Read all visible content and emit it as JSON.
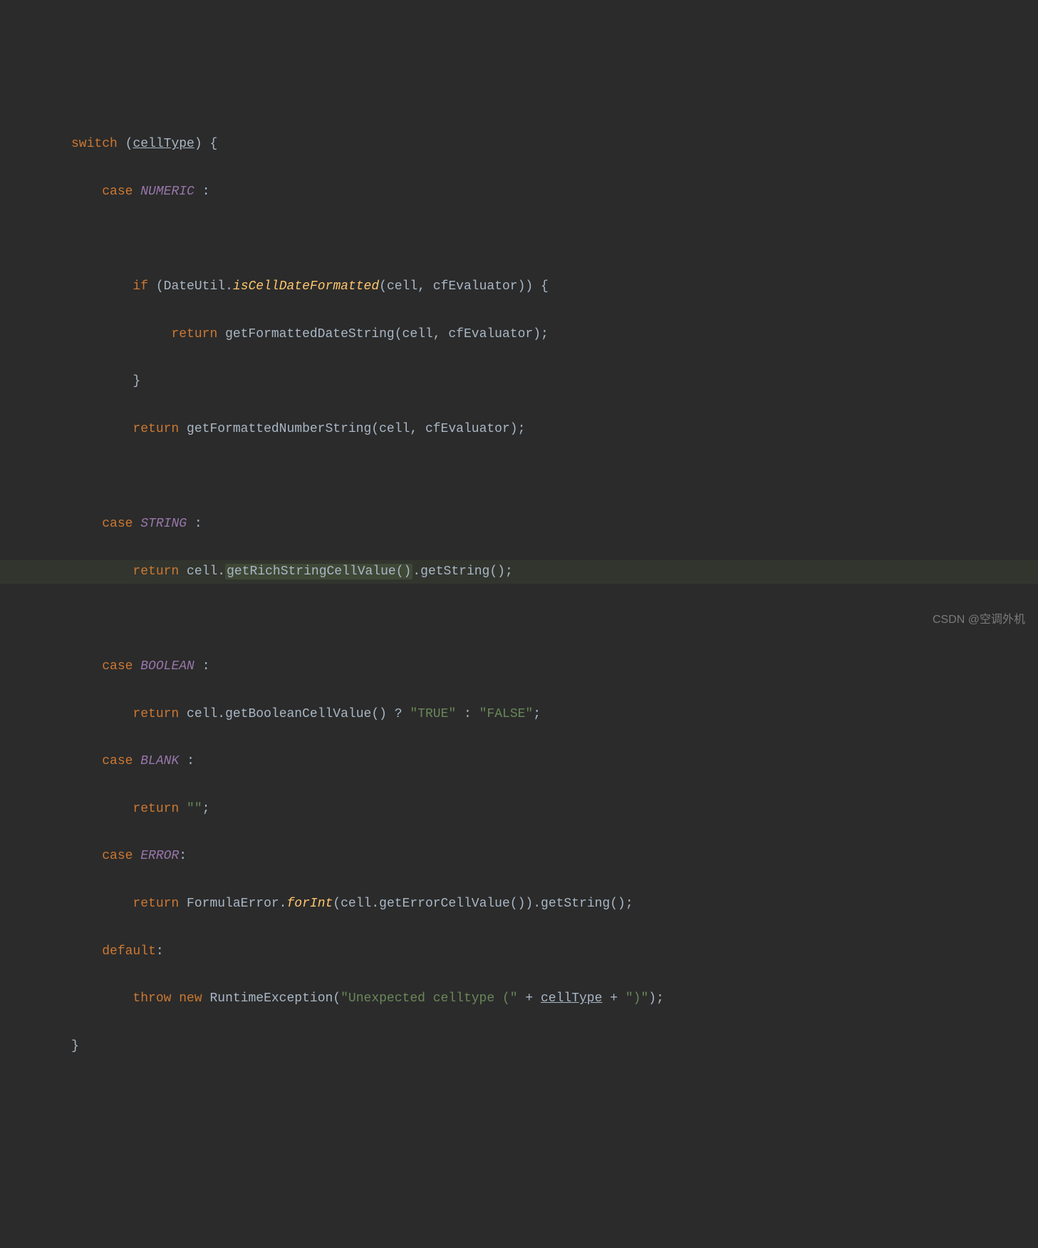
{
  "code": {
    "line1": {
      "switch": "switch",
      "open_paren": "(",
      "var": "cellType",
      "close_paren": ")",
      "brace": "{"
    },
    "line2": {
      "case": "case",
      "enum": "NUMERIC",
      "colon": ":"
    },
    "line4": {
      "if": "if",
      "open": "(",
      "class": "DateUtil",
      "dot": ".",
      "method": "isCellDateFormatted",
      "args_open": "(",
      "arg1": "cell",
      "comma": ",",
      "arg2": "cfEvaluator",
      "args_close": ")",
      "close": ")",
      "brace": "{"
    },
    "line5": {
      "return": "return",
      "method": "getFormattedDateString",
      "open": "(",
      "arg1": "cell",
      "comma": ",",
      "arg2": "cfEvaluator",
      "close": ")",
      "semi": ";"
    },
    "line6": {
      "brace": "}"
    },
    "line7": {
      "return": "return",
      "method": "getFormattedNumberString",
      "open": "(",
      "arg1": "cell",
      "comma": ",",
      "arg2": "cfEvaluator",
      "close": ")",
      "semi": ";"
    },
    "line9": {
      "case": "case",
      "enum": "STRING",
      "colon": ":"
    },
    "line10": {
      "return": "return",
      "obj": "cell",
      "dot1": ".",
      "method1": "getRichStringCellValue",
      "paren1": "()",
      "dot2": ".",
      "method2": "getString",
      "paren2": "()",
      "semi": ";"
    },
    "line12": {
      "case": "case",
      "enum": "BOOLEAN",
      "colon": ":"
    },
    "line13": {
      "return": "return",
      "obj": "cell",
      "dot": ".",
      "method": "getBooleanCellValue",
      "paren": "()",
      "tern1": "?",
      "str1": "\"TRUE\"",
      "tern2": ":",
      "str2": "\"FALSE\"",
      "semi": ";"
    },
    "line14": {
      "case": "case",
      "enum": "BLANK",
      "colon": ":"
    },
    "line15": {
      "return": "return",
      "str": "\"\"",
      "semi": ";"
    },
    "line16": {
      "case": "case",
      "enum": "ERROR",
      "colon": ":"
    },
    "line17": {
      "return": "return",
      "class": "FormulaError",
      "dot1": ".",
      "method1": "forInt",
      "open1": "(",
      "obj": "cell",
      "dot2": ".",
      "method2": "getErrorCellValue",
      "paren2": "()",
      "close1": ")",
      "dot3": ".",
      "method3": "getString",
      "paren3": "()",
      "semi": ";"
    },
    "line18": {
      "default": "default",
      "colon": ":"
    },
    "line19": {
      "throw": "throw",
      "new": "new",
      "class": "RuntimeException",
      "open": "(",
      "str1": "\"Unexpected celltype (\"",
      "plus1": "+",
      "var": "cellType",
      "plus2": "+",
      "str2": "\")\"",
      "close": ")",
      "semi": ";"
    },
    "line20": {
      "brace": "}"
    }
  },
  "watermark": "CSDN @空调外机"
}
